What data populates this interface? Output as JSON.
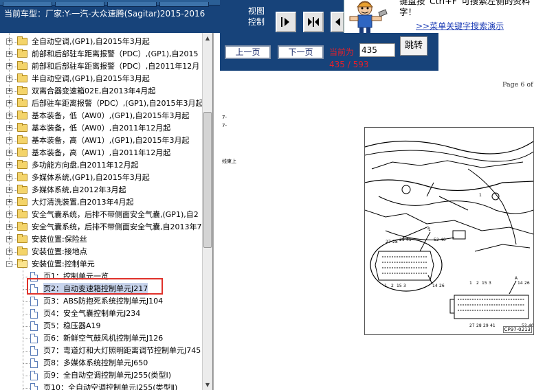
{
  "header": {
    "car_model": "当前车型：厂家:Y-一汽-大众速腾(Sagitar)2015-2016",
    "view_label": "视图\n控制"
  },
  "hint": {
    "text": "键盘按“Ctrl+F”可搜索左侧的资料\n字！",
    "link": ">>菜单关键字搜索演示"
  },
  "tree": {
    "nodes": [
      {
        "label": "全自动空调,(GP1),自2015年3月起",
        "expander": "+"
      },
      {
        "label": "前部和后部驻车距离报警（PDC）,(GP1),自2015",
        "expander": "+"
      },
      {
        "label": "前部和后部驻车距离报警（PDC）,自2011年12月",
        "expander": "+"
      },
      {
        "label": "半自动空调,(GP1),自2015年3月起",
        "expander": "+"
      },
      {
        "label": "双离合器变速箱02E,自2013年4月起",
        "expander": "+"
      },
      {
        "label": "后部驻车距离报警（PDC）,(GP1),自2015年3月起",
        "expander": "+"
      },
      {
        "label": "基本装备，低（AW0）,(GP1),自2015年3月起",
        "expander": "+"
      },
      {
        "label": "基本装备，低（AW0）,自2011年12月起",
        "expander": "+"
      },
      {
        "label": "基本装备，高（AW1）,(GP1),自2015年3月起",
        "expander": "+"
      },
      {
        "label": "基本装备，高（AW1）,自2011年12月起",
        "expander": "+"
      },
      {
        "label": "多功能方向盘,自2011年12月起",
        "expander": "+"
      },
      {
        "label": "多媒体系统,(GP1),自2015年3月起",
        "expander": "+"
      },
      {
        "label": "多媒体系统,自2012年3月起",
        "expander": "+"
      },
      {
        "label": "大灯清洗装置,自2013年4月起",
        "expander": "+"
      },
      {
        "label": "安全气囊系统，后排不带侧面安全气囊,(GP1),自2",
        "expander": "+"
      },
      {
        "label": "安全气囊系统，后排不带侧面安全气囊,自2013年7",
        "expander": "+"
      },
      {
        "label": "安装位置:保险丝",
        "expander": "+"
      },
      {
        "label": "安装位置:接地点",
        "expander": "+"
      },
      {
        "label": "安装位置:控制单元",
        "expander": "-"
      }
    ],
    "pages": [
      "页1：控制单元一览",
      "页2：自动变速箱控制单元J217",
      "页3：ABS防抱死系统控制单元J104",
      "页4：安全气囊控制单元J234",
      "页5：稳压器A19",
      "页6：新鲜空气鼓风机控制单元J126",
      "页7：弯道灯和大灯照明距离调节控制单元J745",
      "页8：多媒体系统控制单元J650",
      "页9：全自动空调控制单元J255(类型Ⅰ)",
      "页10：全自动空调控制单元J255(类型Ⅱ)"
    ]
  },
  "nav": {
    "prev": "上一页",
    "next": "下一页",
    "current_label": "当前为",
    "current_page": "435",
    "go": "跳转",
    "count": "435 / 593"
  },
  "document": {
    "page_of": "Page 6 of",
    "fragment_a": "7-",
    "fragment_b": "7-",
    "fragment_c": "线束上",
    "callouts": [
      "1",
      "1",
      "1",
      "A"
    ],
    "pin_top_left": [
      "27",
      "28",
      "29",
      "41",
      "52",
      "40"
    ],
    "pin_bottom_left": [
      "1",
      "2",
      "15",
      "3",
      "14",
      "26"
    ],
    "pin_top_right": [
      "1",
      "2",
      "15",
      "3",
      "14",
      "26"
    ],
    "pin_bottom_right": [
      "27",
      "28",
      "29",
      "41",
      "52",
      "40"
    ],
    "figure_code": "CP97-0213"
  },
  "colors": {
    "header_bg": "#17437a",
    "highlight": "#e0312a",
    "page_count": "#e4202a"
  }
}
